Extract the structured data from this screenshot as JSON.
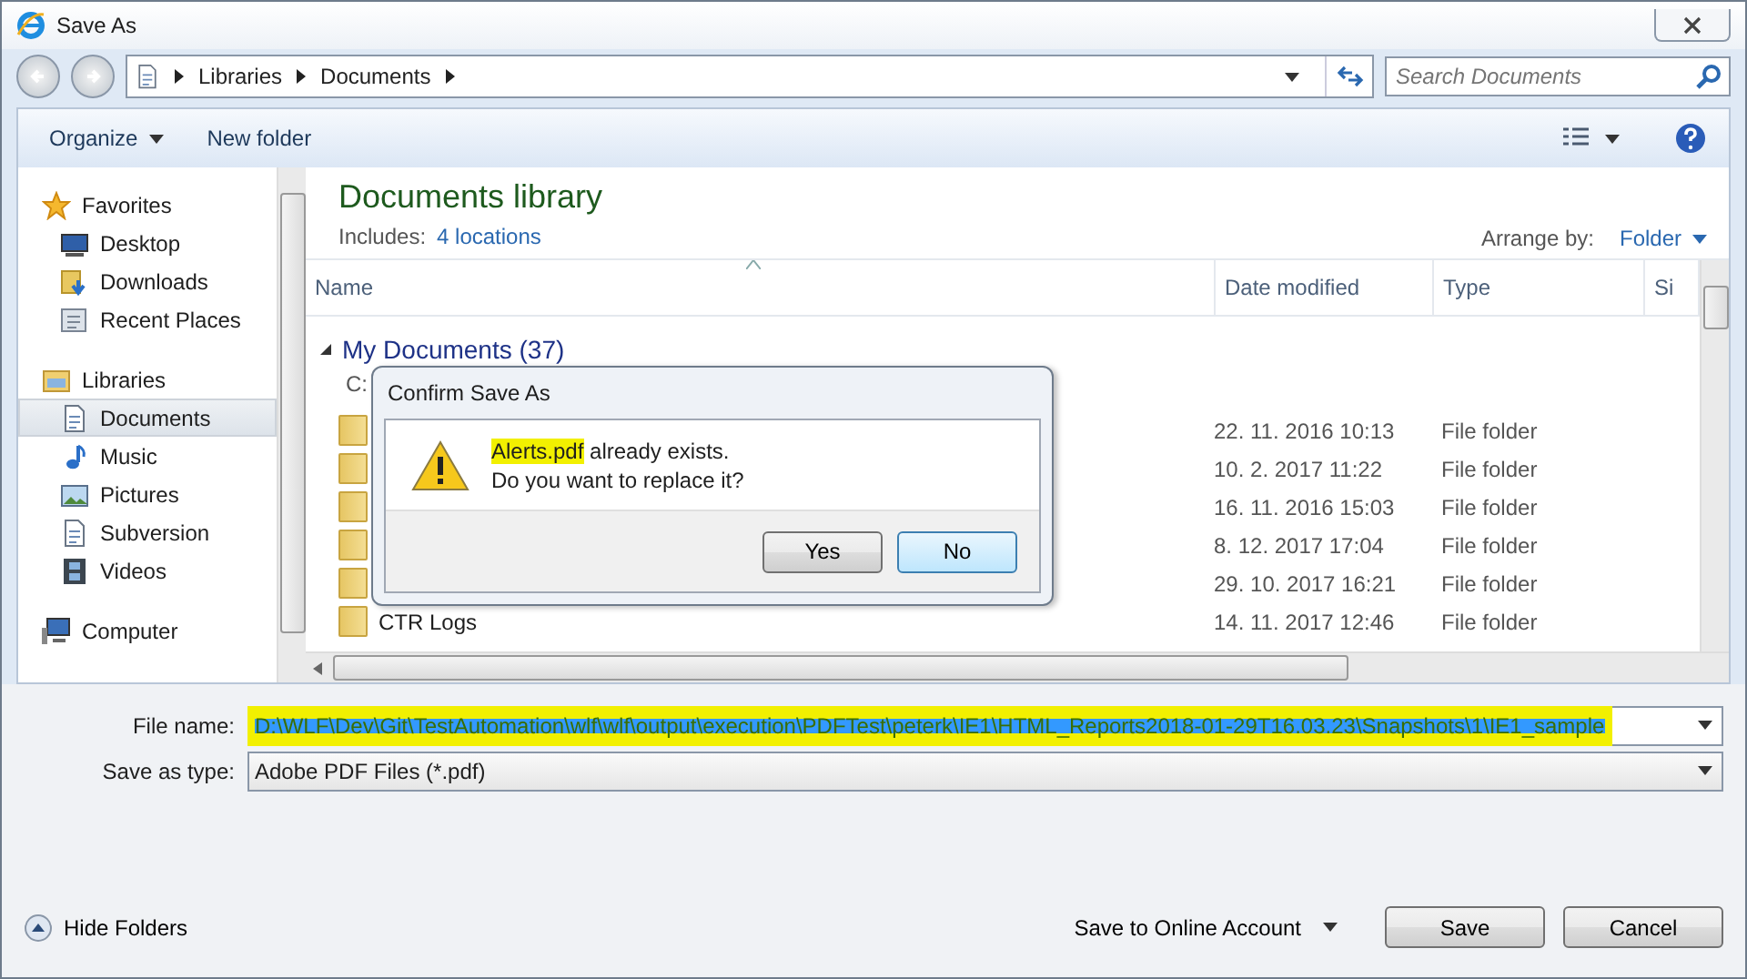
{
  "window": {
    "title": "Save As"
  },
  "address": {
    "crumbs": [
      "Libraries",
      "Documents"
    ]
  },
  "search": {
    "placeholder": "Search Documents"
  },
  "toolbar": {
    "buttons": [
      {
        "label": "Organize",
        "menu": true
      },
      {
        "label": "New folder",
        "menu": false
      }
    ]
  },
  "sidebar": {
    "sections": [
      {
        "label": "Favorites",
        "kind": "star",
        "children": [
          {
            "label": "Desktop",
            "kind": "desktop",
            "selected": false
          },
          {
            "label": "Downloads",
            "kind": "download",
            "selected": false
          },
          {
            "label": "Recent Places",
            "kind": "recent",
            "selected": false
          }
        ]
      },
      {
        "label": "Libraries",
        "kind": "library",
        "children": [
          {
            "label": "Documents",
            "kind": "document",
            "selected": true
          },
          {
            "label": "Music",
            "kind": "music",
            "selected": false
          },
          {
            "label": "Pictures",
            "kind": "picture",
            "selected": false
          },
          {
            "label": "Subversion",
            "kind": "document",
            "selected": false
          },
          {
            "label": "Videos",
            "kind": "video",
            "selected": false
          }
        ]
      },
      {
        "label": "Computer",
        "kind": "computer"
      }
    ]
  },
  "library": {
    "title": "Documents library",
    "includes_label": "Includes:",
    "includes_link": "4 locations",
    "arrange_label": "Arrange by:",
    "arrange_value": "Folder"
  },
  "table": {
    "columns": [
      "Name",
      "Date modified",
      "Type",
      "Si"
    ],
    "group": {
      "title": "My Documents (37)",
      "path": "C:",
      "expanded": true
    },
    "rows": [
      {
        "date": "22. 11. 2016 10:13",
        "type": "File folder"
      },
      {
        "date": "10. 2. 2017 11:22",
        "type": "File folder"
      },
      {
        "date": "16. 11. 2016 15:03",
        "type": "File folder"
      },
      {
        "date": "8. 12. 2017 17:04",
        "type": "File folder"
      },
      {
        "date": "29. 10. 2017 16:21",
        "type": "File folder"
      },
      {
        "name": "CTR Logs",
        "date": "14. 11. 2017 12:46",
        "type": "File folder"
      }
    ]
  },
  "file_name": {
    "label": "File name:",
    "value": "D:\\WLF\\Dev\\Git\\TestAutomation\\wlf\\wlf\\output\\execution\\PDFTest\\peterk\\IE1\\HTML_Reports2018-01-29T16.03.23\\Snapshots\\1\\IE1_sample",
    "selected": true,
    "highlighted": true
  },
  "save_type": {
    "label": "Save as type:",
    "value": "Adobe PDF Files (*.pdf)"
  },
  "footer": {
    "hide_folders": "Hide Folders",
    "online": "Save to Online Account",
    "buttons": [
      {
        "label": "Save",
        "default": false
      },
      {
        "label": "Cancel",
        "default": false
      }
    ]
  },
  "confirm": {
    "title": "Confirm Save As",
    "lines": [
      {
        "highlight": "Alerts.pdf",
        "text": " already exists."
      },
      {
        "text": "Do you want to replace it?"
      }
    ],
    "buttons": [
      {
        "label": "Yes",
        "focused": false
      },
      {
        "label": "No",
        "focused": true
      }
    ]
  }
}
